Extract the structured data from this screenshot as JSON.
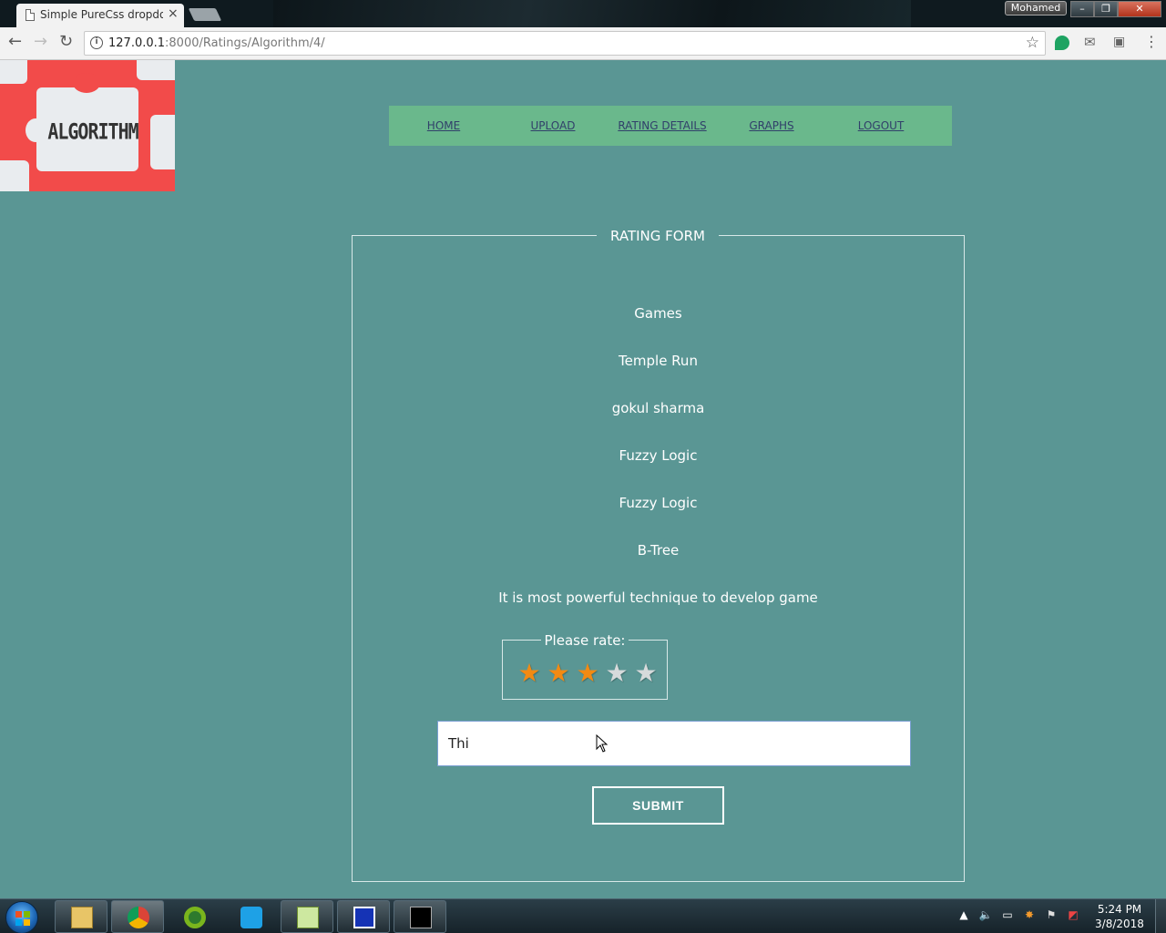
{
  "browser": {
    "tab_title": "Simple PureCss dropdow",
    "tab_close": "×",
    "user_badge": "Mohamed",
    "window_min": "–",
    "window_max": "❐",
    "window_close": "✕",
    "url_host": "127.0.0.1",
    "url_path": ":8000/Ratings/Algorithm/4/",
    "info_icon": "i"
  },
  "logo": {
    "text": "ALGORITHM"
  },
  "menu": {
    "items": [
      {
        "label": "HOME",
        "active": true
      },
      {
        "label": "UPLOAD"
      },
      {
        "label": "RATING DETAILS"
      },
      {
        "label": "GRAPHS"
      },
      {
        "label": "LOGOUT"
      }
    ]
  },
  "form": {
    "legend": "RATING FORM",
    "lines": [
      "Games",
      "Temple Run",
      "gokul sharma",
      "Fuzzy Logic",
      "Fuzzy Logic",
      "B-Tree",
      "It is most powerful technique to develop game"
    ],
    "rating_label": "Please rate:",
    "rating_value": 3,
    "rating_max": 5,
    "comment_value": "Thi",
    "submit_label": "SUBMIT"
  },
  "colors": {
    "page_bg": "#5a9694",
    "menu_bg": "#6ab88c",
    "menu_active_bar": "#3f8a5c",
    "star_on": "#f28a13",
    "star_off": "#d6dadb"
  },
  "taskbar": {
    "apps": [
      "file-explorer-icon",
      "chrome-icon",
      "chameleon-icon",
      "app-icon",
      "notepad-plus-icon",
      "virtualbox-icon",
      "command-prompt-icon"
    ],
    "clock_time": "5:24 PM",
    "clock_date": "3/8/2018"
  }
}
